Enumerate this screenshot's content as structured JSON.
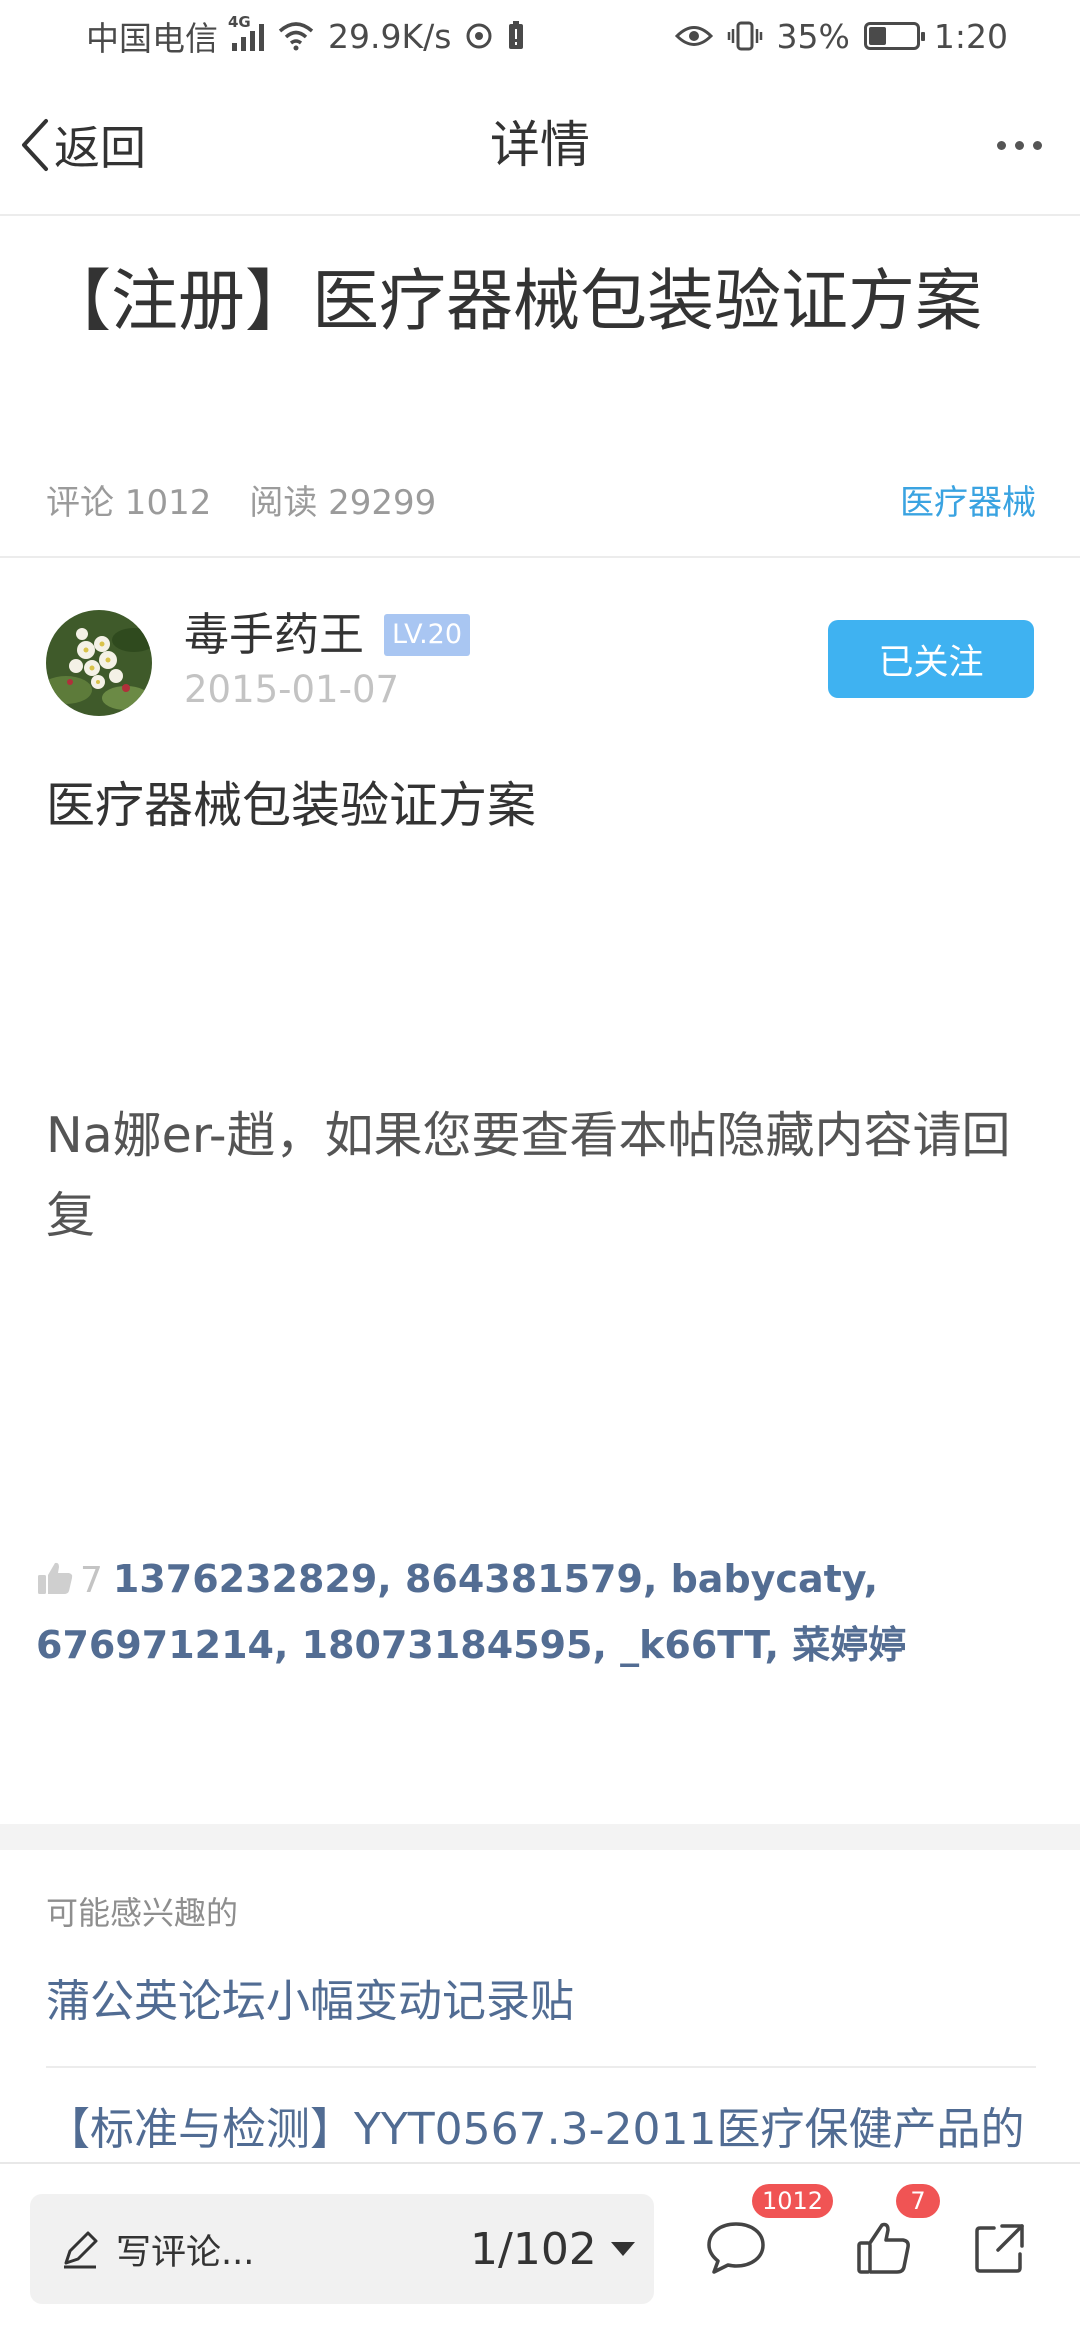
{
  "status_bar": {
    "carrier": "中国电信",
    "network": "4G",
    "speed": "29.9K/s",
    "battery": "35%",
    "battery_level": 0.35,
    "time": "1:20"
  },
  "nav": {
    "back_label": "返回",
    "title": "详情"
  },
  "post": {
    "title": "【注册】医疗器械包装验证方案",
    "comments": "评论 1012",
    "reads": "阅读 29299",
    "category": "医疗器械",
    "author": {
      "name": "毒手药王",
      "level": "LV.20",
      "date": "2015-01-07",
      "follow_label": "已关注"
    },
    "body": "医疗器械包装验证方案",
    "hidden_notice": "Na娜er-趙，如果您要查看本帖隐藏内容请回复",
    "like_count": "7",
    "likers": "1376232829, 864381579, babycaty, 676971214, 18073184595, _k66TT, 菜婷婷"
  },
  "recommendations": {
    "heading": "可能感兴趣的",
    "items": [
      "蒲公英论坛小幅变动记录贴",
      "【标准与检测】YYT0567.3-2011医疗保健产品的"
    ]
  },
  "bottom_bar": {
    "comment_placeholder": "写评论...",
    "page_indicator": "1/102",
    "comment_badge": "1012",
    "like_badge": "7"
  },
  "colors": {
    "accent_blue": "#3fb2f1",
    "category_blue": "#3aa3e1",
    "link_blue": "#516c93",
    "badge_red": "#f05454",
    "level_badge": "#a9c6f2"
  }
}
